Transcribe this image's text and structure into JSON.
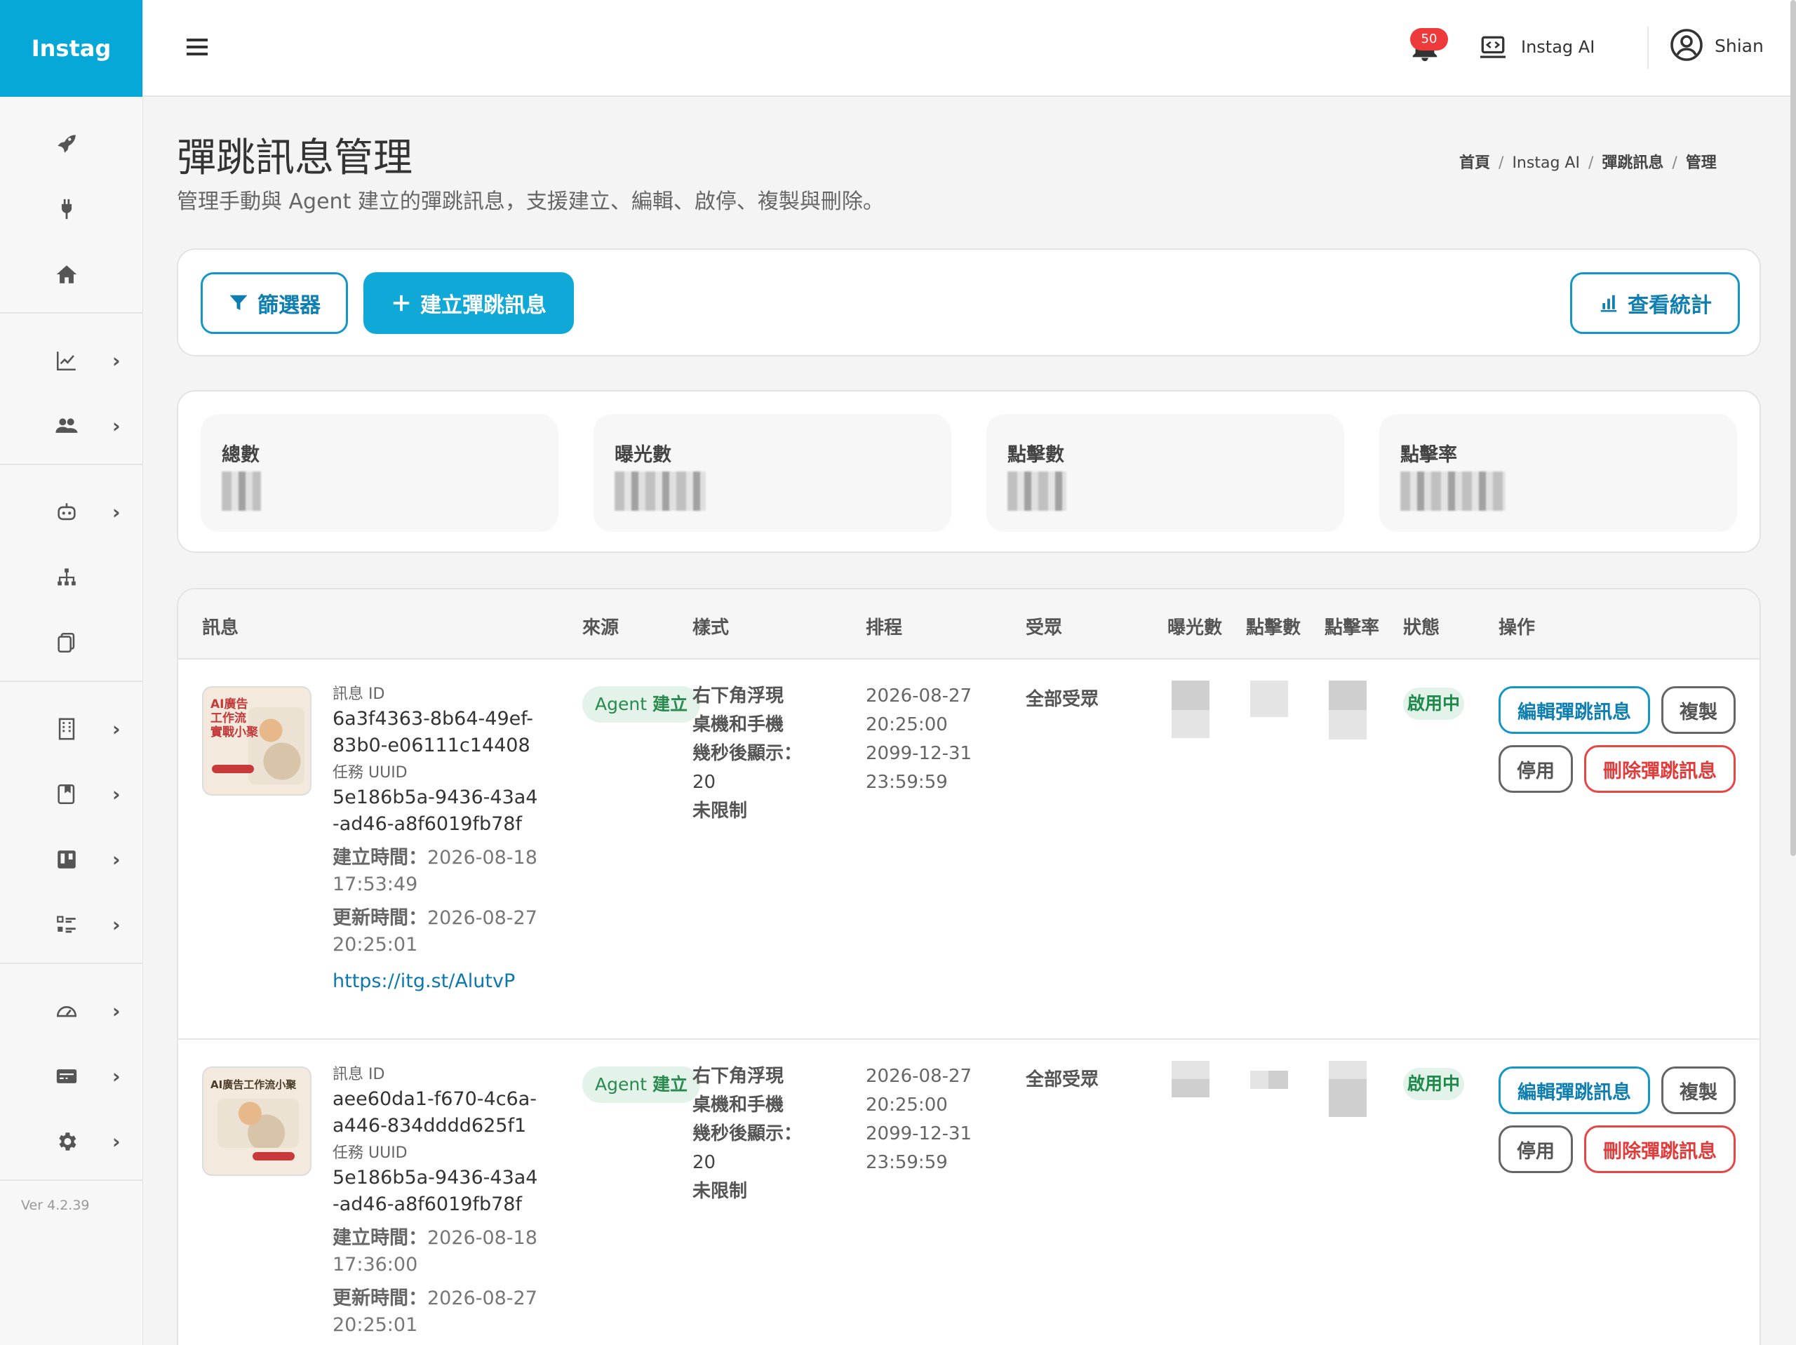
{
  "app": {
    "brand": "Instag",
    "version": "Ver 4.2.39"
  },
  "topbar": {
    "notification_count": "50",
    "ai_label": "Instag AI",
    "user_name": "Shian"
  },
  "sidebar": {
    "items": [
      {
        "icon": "rocket-icon",
        "chevron": false
      },
      {
        "icon": "plug-icon",
        "chevron": false
      },
      {
        "icon": "home-icon",
        "chevron": false
      },
      {
        "icon": "chart-line-icon",
        "chevron": true
      },
      {
        "icon": "users-icon",
        "chevron": true
      },
      {
        "icon": "robot-icon",
        "chevron": true
      },
      {
        "icon": "sitemap-icon",
        "chevron": true
      },
      {
        "icon": "copy-icon",
        "chevron": false
      },
      {
        "icon": "building-icon",
        "chevron": true
      },
      {
        "icon": "bookmark-book-icon",
        "chevron": true
      },
      {
        "icon": "board-icon",
        "chevron": true
      },
      {
        "icon": "tasks-icon",
        "chevron": true
      },
      {
        "icon": "gauge-icon",
        "chevron": true
      },
      {
        "icon": "id-card-icon",
        "chevron": true
      },
      {
        "icon": "gear-icon",
        "chevron": true
      }
    ]
  },
  "page": {
    "title": "彈跳訊息管理",
    "subtitle": "管理手動與 Agent 建立的彈跳訊息，支援建立、編輯、啟停、複製與刪除。",
    "breadcrumb": [
      "首頁",
      "Instag AI",
      "彈跳訊息",
      "管理"
    ]
  },
  "toolbar": {
    "filter_label": "篩選器",
    "create_label": "建立彈跳訊息",
    "stats_label": "查看統計"
  },
  "stats": [
    {
      "label": "總數"
    },
    {
      "label": "曝光數"
    },
    {
      "label": "點擊數"
    },
    {
      "label": "點擊率"
    }
  ],
  "table": {
    "headers": [
      "訊息",
      "來源",
      "樣式",
      "排程",
      "受眾",
      "曝光數",
      "點擊數",
      "點擊率",
      "狀態",
      "操作"
    ],
    "rows": [
      {
        "msg_id_label": "訊息 ID",
        "msg_id": "6a3f4363-8b64-49ef-83b0-e06111c14408",
        "task_label": "任務 UUID",
        "task_uuid": "5e186b5a-9436-43a4-ad46-a8f6019fb78f",
        "created_label": "建立時間：",
        "created": "2026-08-18 17:53:49",
        "updated_label": "更新時間：",
        "updated": "2026-08-27 20:25:01",
        "link": "https://itg.st/AlutvP",
        "source_a": "Agent",
        "source_b": "建立",
        "style_position": "右下角浮現",
        "style_device": "桌機和手機",
        "style_delay_label": "幾秒後顯示：",
        "style_delay": "20",
        "style_limit": "未限制",
        "schedule_start_date": "2026-08-27",
        "schedule_start_time": "20:25:00",
        "schedule_end_date": "2099-12-31",
        "schedule_end_time": "23:59:59",
        "audience": "全部受眾",
        "status": "啟用中",
        "thumb_text": "AI廣告\n工作流\n實戰小聚"
      },
      {
        "msg_id_label": "訊息 ID",
        "msg_id": "aee60da1-f670-4c6a-a446-834dddd625f1",
        "task_label": "任務 UUID",
        "task_uuid": "5e186b5a-9436-43a4-ad46-a8f6019fb78f",
        "created_label": "建立時間：",
        "created": "2026-08-18 17:36:00",
        "updated_label": "更新時間：",
        "updated": "2026-08-27 20:25:01",
        "link": "",
        "source_a": "Agent",
        "source_b": "建立",
        "style_position": "右下角浮現",
        "style_device": "桌機和手機",
        "style_delay_label": "幾秒後顯示：",
        "style_delay": "20",
        "style_limit": "未限制",
        "schedule_start_date": "2026-08-27",
        "schedule_start_time": "20:25:00",
        "schedule_end_date": "2099-12-31",
        "schedule_end_time": "23:59:59",
        "audience": "全部受眾",
        "status": "啟用中",
        "thumb_text": "AI廣告工作流小聚"
      }
    ],
    "actions": {
      "edit": "編輯彈跳訊息",
      "copy": "複製",
      "pause": "停用",
      "delete": "刪除彈跳訊息"
    }
  }
}
